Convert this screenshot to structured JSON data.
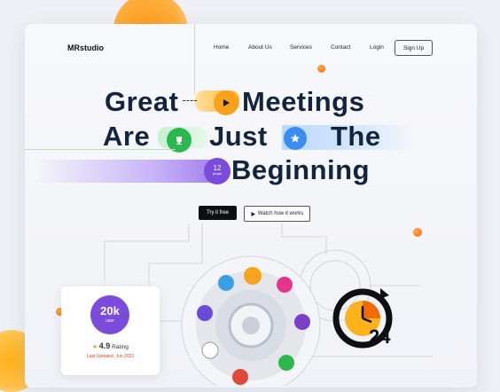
{
  "brand": "MRstudio",
  "nav": {
    "home": "Home",
    "about": "About Us",
    "services": "Services",
    "contact": "Contact",
    "login": "Login",
    "signup": "Sign Up"
  },
  "hero": {
    "w1": "Great",
    "w2": "Meetings",
    "w3": "Are",
    "w4": "Just",
    "w5": "The",
    "w6": "Beginning",
    "badge_number": "12",
    "badge_unit": "people"
  },
  "cta": {
    "primary": "Try it free",
    "secondary": "Watch how it works"
  },
  "stat_card": {
    "users_count": "20k",
    "users_label": "user",
    "rating_value": "4.9",
    "rating_label": "Rating",
    "updated": "Last Updated, Jun 2022"
  },
  "clock_badge": "24",
  "colors": {
    "heading": "#13243d",
    "accent_purple": "#7b4bdc",
    "accent_orange": "#f7931e",
    "accent_green": "#2db84f",
    "accent_blue": "#3a8cf0"
  }
}
